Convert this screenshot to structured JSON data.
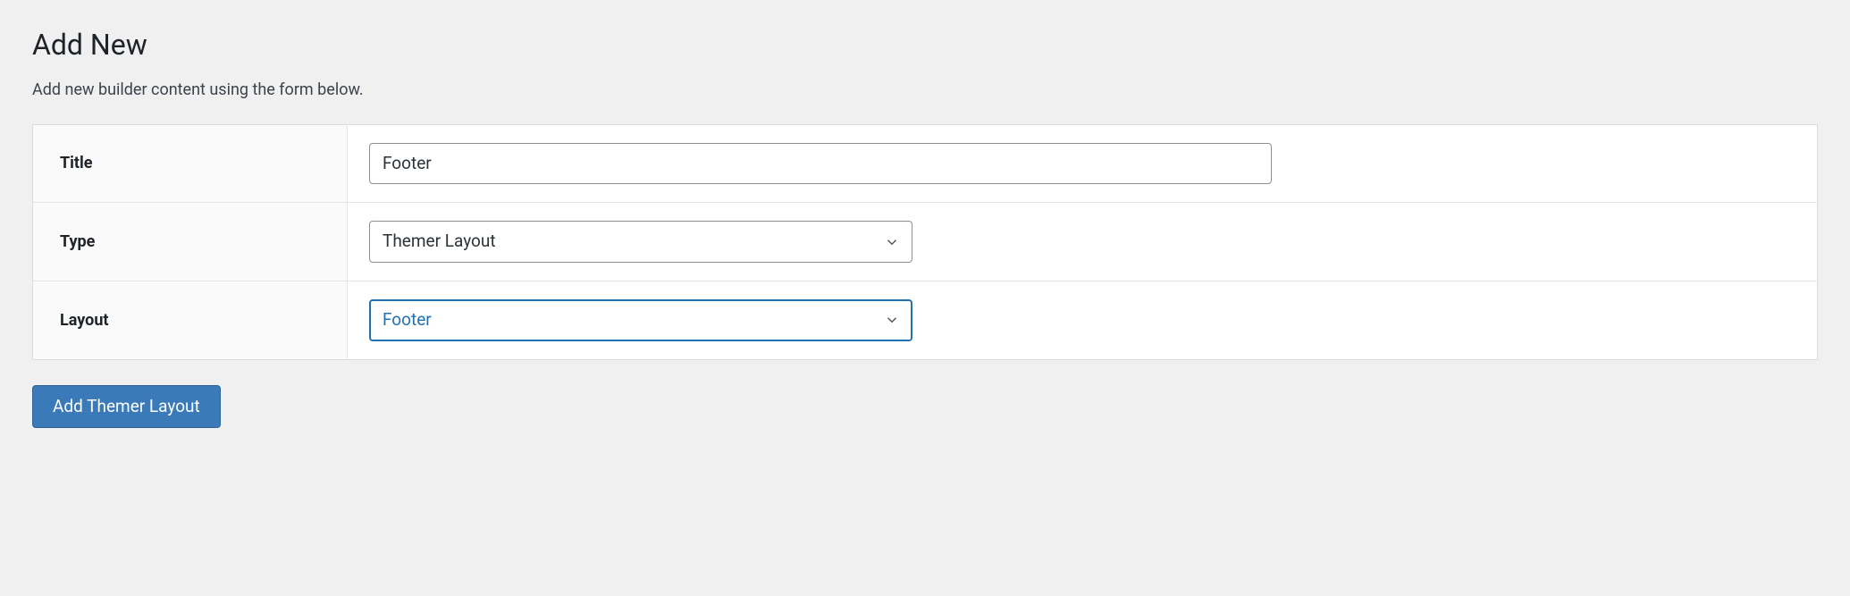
{
  "page": {
    "title": "Add New",
    "description": "Add new builder content using the form below."
  },
  "form": {
    "title": {
      "label": "Title",
      "value": "Footer"
    },
    "type": {
      "label": "Type",
      "value": "Themer Layout"
    },
    "layout": {
      "label": "Layout",
      "value": "Footer"
    }
  },
  "submit": {
    "label": "Add Themer Layout"
  }
}
